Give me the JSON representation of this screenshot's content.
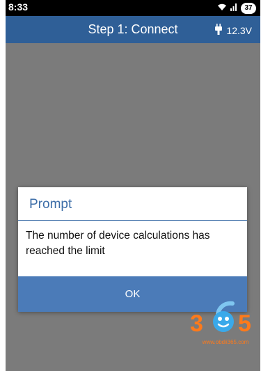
{
  "status_bar": {
    "time": "8:33",
    "battery_level": "37",
    "icons": [
      "wifi-icon",
      "signal-icon",
      "battery-icon"
    ]
  },
  "app_bar": {
    "title": "Step 1: Connect",
    "voltage": "12.3V",
    "voltage_icon": "plug-icon",
    "background": "#2f5f97"
  },
  "dialog": {
    "title": "Prompt",
    "message": "The number of device calculations has reached the limit",
    "ok_label": "OK",
    "accent": "#3d6ea8",
    "button_color": "#4b7bb8"
  },
  "watermark": {
    "logo_text": "365",
    "url": "www.obdii365.com",
    "color": "#ff7a1a"
  }
}
